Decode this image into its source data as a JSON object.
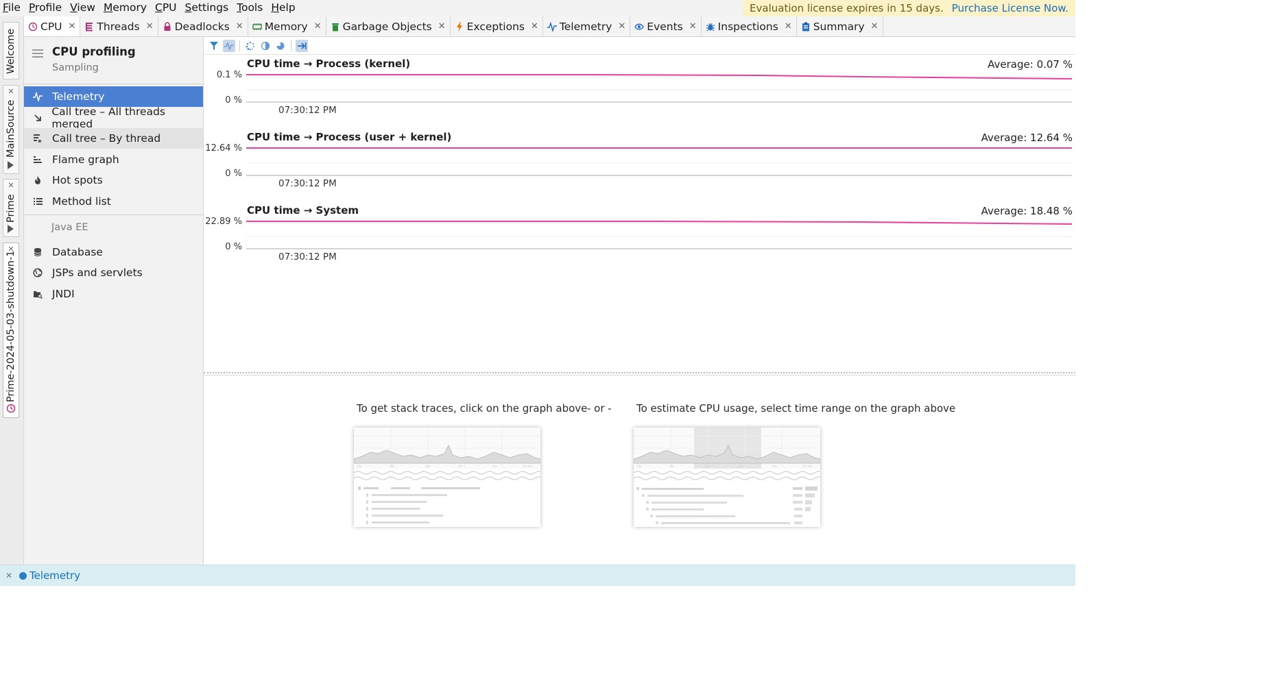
{
  "menu": [
    "File",
    "Profile",
    "View",
    "Memory",
    "CPU",
    "Settings",
    "Tools",
    "Help"
  ],
  "menu_mnemonics": [
    "F",
    "P",
    "V",
    "M",
    "C",
    "S",
    "T",
    "H"
  ],
  "license": {
    "message": "Evaluation license expires in 15 days.",
    "link": "Purchase License Now."
  },
  "side_tabs": {
    "welcome": "Welcome",
    "mainsource": "MainSource",
    "prime": "Prime",
    "snapshot": "Prime-2024-05-03-shutdown-1"
  },
  "tabs": [
    {
      "label": "CPU",
      "icon": "cpu-clock-icon",
      "active": true
    },
    {
      "label": "Threads",
      "icon": "threads-icon"
    },
    {
      "label": "Deadlocks",
      "icon": "lock-icon"
    },
    {
      "label": "Memory",
      "icon": "memory-chip-icon"
    },
    {
      "label": "Garbage Objects",
      "icon": "trash-icon"
    },
    {
      "label": "Exceptions",
      "icon": "lightning-icon"
    },
    {
      "label": "Telemetry",
      "icon": "pulse-icon"
    },
    {
      "label": "Events",
      "icon": "eye-icon"
    },
    {
      "label": "Inspections",
      "icon": "bug-icon"
    },
    {
      "label": "Summary",
      "icon": "clipboard-icon"
    }
  ],
  "sidebar": {
    "title": "CPU profiling",
    "subtitle": "Sampling",
    "items": [
      {
        "label": "Telemetry",
        "icon": "pulse-icon",
        "selected": true
      },
      {
        "label": "Call tree – All threads merged",
        "icon": "arrow-down-right-icon"
      },
      {
        "label": "Call tree – By thread",
        "icon": "thread-tree-icon",
        "hover": true
      },
      {
        "label": "Flame graph",
        "icon": "flame-graph-icon"
      },
      {
        "label": "Hot spots",
        "icon": "fire-icon"
      },
      {
        "label": "Method list",
        "icon": "list-icon"
      }
    ],
    "section_label": "Java EE",
    "javaee_items": [
      {
        "label": "Database",
        "icon": "database-icon"
      },
      {
        "label": "JSPs and servlets",
        "icon": "globe-icon"
      },
      {
        "label": "JNDI",
        "icon": "folder-search-icon"
      }
    ]
  },
  "toolbar_icons": [
    "filter-icon",
    "telemetry-toggle-icon",
    "spinner-icon",
    "pie-half-icon",
    "pie-icon",
    "export-arrow-icon"
  ],
  "graphs": [
    {
      "title": "CPU time → Process (kernel)",
      "average": "Average: 0.07 %",
      "ymax_label": "0.1 %",
      "ymin_label": "0 %",
      "time_label": "07:30:12 PM",
      "series_color": "#e8409a"
    },
    {
      "title": "CPU time → Process (user + kernel)",
      "average": "Average: 12.64 %",
      "ymax_label": "12.64 %",
      "ymin_label": "0 %",
      "time_label": "07:30:12 PM",
      "series_color": "#e8409a"
    },
    {
      "title": "CPU time → System",
      "average": "Average: 18.48 %",
      "ymax_label": "22.89 %",
      "ymin_label": "0 %",
      "time_label": "07:30:12 PM",
      "series_color": "#e8409a"
    }
  ],
  "hints": {
    "stack_traces": "To get stack traces, click on the graph above",
    "or": "- or -",
    "estimate": "To estimate CPU usage, select time range on the graph above"
  },
  "status": {
    "label": "Telemetry"
  }
}
